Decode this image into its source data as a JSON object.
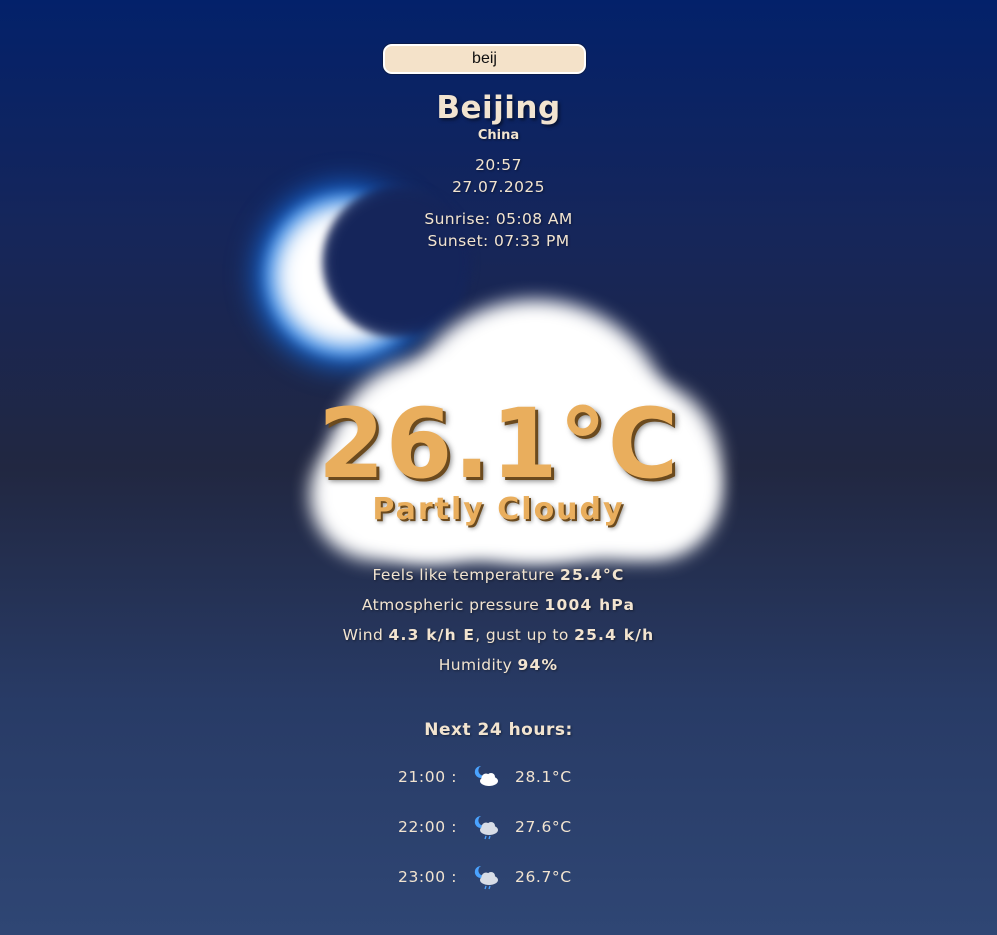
{
  "search": {
    "value": "beij"
  },
  "location": {
    "city": "Beijing",
    "country": "China"
  },
  "time": {
    "clock": "20:57",
    "date": "27.07.2025"
  },
  "sun": {
    "sunrise_label": "Sunrise:",
    "sunrise": "05:08 AM",
    "sunset_label": "Sunset:",
    "sunset": "07:33 PM"
  },
  "current": {
    "temperature": "26.1°C",
    "condition": "Partly Cloudy"
  },
  "details": {
    "feels_label": "Feels like temperature",
    "feels_value": "25.4°C",
    "pressure_label": "Atmospheric pressure",
    "pressure_value": "1004 hPa",
    "wind_label": "Wind",
    "wind_value": "4.3 k/h E",
    "gust_label": ", gust up to",
    "gust_value": "25.4 k/h",
    "humidity_label": "Humidity",
    "humidity_value": "94%"
  },
  "forecast": {
    "title": "Next 24 hours:",
    "hours": [
      {
        "time": "21:00 :",
        "icon": "moon-cloud-icon",
        "temp": "28.1°C"
      },
      {
        "time": "22:00 :",
        "icon": "moon-cloud-rain-icon",
        "temp": "27.6°C"
      },
      {
        "time": "23:00 :",
        "icon": "moon-cloud-rain-icon",
        "temp": "26.7°C"
      }
    ]
  },
  "colors": {
    "accent": "#e9ae5d",
    "text": "#f2e4d0",
    "input_bg": "#f4e2c9"
  }
}
